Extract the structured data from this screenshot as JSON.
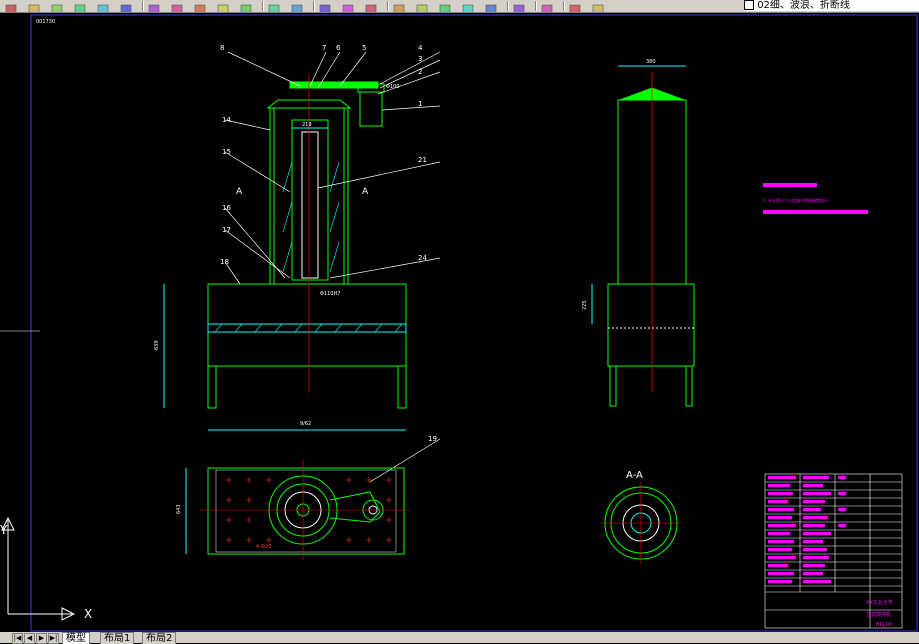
{
  "toolbar": {
    "layer_value": "02细、波浪、折断线",
    "buttons": [
      "new-icon",
      "open-icon",
      "save-icon",
      "print-icon",
      "preview-icon",
      "publish-icon",
      "cut-icon",
      "copy-icon",
      "paste-icon",
      "match-prop-icon",
      "undo-icon",
      "redo-icon",
      "pan-icon",
      "zoom-realtime-icon",
      "zoom-window-icon",
      "zoom-previous-icon",
      "properties-icon",
      "design-center-icon",
      "tool-palette-icon",
      "sheet-set-icon",
      "markup-icon",
      "calculator-icon",
      "help-icon",
      "layer-manager-icon",
      "layer-state-icon"
    ]
  },
  "tabs": {
    "model": "模型",
    "layout1": "布局1",
    "layout2": "布局2"
  },
  "drawing": {
    "title_stamp": "001730",
    "balloons": [
      "8",
      "7",
      "6",
      "5",
      "4",
      "3",
      "2",
      "1",
      "14",
      "15",
      "21",
      "16",
      "17",
      "24",
      "18",
      "19"
    ],
    "section_marker": "A",
    "section_title": "A-A",
    "dims": {
      "shaft_width": "219",
      "side_top": "380",
      "side_height": "225",
      "base_height": "639",
      "base_width": "9/62",
      "plan_height": "643",
      "bore_fit": "Φ110H7",
      "motor_note": "Φ100",
      "hole_pattern": "4-Φ28"
    },
    "note_text": "1. 未注明尺寸公差按中等级精度执行",
    "title_block": {
      "school": "XX工业大学",
      "drawing_name": "立式搅拌机",
      "code": "BKJ-00"
    }
  },
  "ucs": {
    "x_label": "X",
    "y_label": "Y"
  },
  "colors": {
    "background": "#000000",
    "outline": "#00ff00",
    "hatch": "#00ffff",
    "centerline": "#ff0000",
    "text": "#ffffff",
    "dim": "#00ffff",
    "highlight": "#ff00ff",
    "leader": "#ffffff"
  }
}
